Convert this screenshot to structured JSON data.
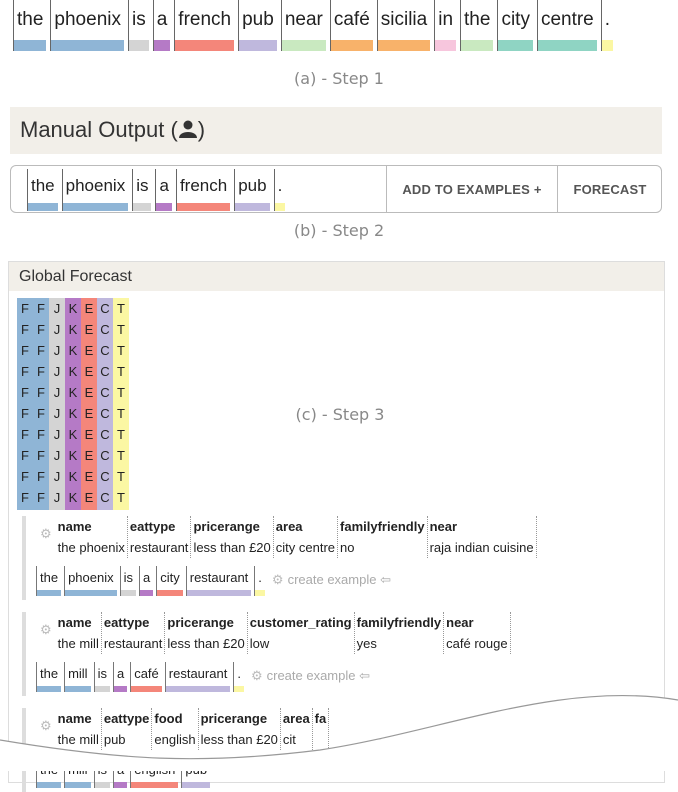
{
  "colors": {
    "blue": "#8fb5d6",
    "gray": "#d4d4d4",
    "purple": "#b57ac6",
    "salmon": "#f4867a",
    "lavender": "#bfb8dd",
    "green": "#c9e9c0",
    "orange": "#f8b26a",
    "pink": "#f7c6dd",
    "teal": "#8fd4c3",
    "yellow": "#fbf7a3",
    "header_bg": "#f2efe9"
  },
  "step1": {
    "tokens": [
      {
        "text": "the",
        "color": "blue"
      },
      {
        "text": "phoenix",
        "color": "blue"
      },
      {
        "text": "is",
        "color": "gray"
      },
      {
        "text": "a",
        "color": "purple"
      },
      {
        "text": "french",
        "color": "salmon"
      },
      {
        "text": "pub",
        "color": "lavender"
      },
      {
        "text": "near",
        "color": "green"
      },
      {
        "text": "café",
        "color": "orange"
      },
      {
        "text": "sicilia",
        "color": "orange"
      },
      {
        "text": "in",
        "color": "pink"
      },
      {
        "text": "the",
        "color": "green"
      },
      {
        "text": "city",
        "color": "teal"
      },
      {
        "text": "centre",
        "color": "teal"
      },
      {
        "text": ".",
        "color": "yellow"
      }
    ],
    "caption": "(a) - Step 1"
  },
  "manual": {
    "title": "Manual Output",
    "user_icon": "user-icon",
    "tokens": [
      {
        "text": "the",
        "color": "blue"
      },
      {
        "text": "phoenix",
        "color": "blue"
      },
      {
        "text": "is",
        "color": "gray"
      },
      {
        "text": "a",
        "color": "purple"
      },
      {
        "text": "french",
        "color": "salmon"
      },
      {
        "text": "pub",
        "color": "lavender"
      },
      {
        "text": ".",
        "color": "yellow"
      }
    ],
    "add_button": "ADD TO EXAMPLES +",
    "forecast_button": "FORECAST",
    "caption": "(b) - Step 2"
  },
  "global": {
    "title": "Global Forecast",
    "caption": "(c) - Step 3",
    "grid": {
      "columns": [
        {
          "letter": "F",
          "color": "blue"
        },
        {
          "letter": "F",
          "color": "blue"
        },
        {
          "letter": "J",
          "color": "gray"
        },
        {
          "letter": "K",
          "color": "purple"
        },
        {
          "letter": "E",
          "color": "salmon"
        },
        {
          "letter": "C",
          "color": "lavender"
        },
        {
          "letter": "T",
          "color": "yellow"
        }
      ],
      "rows": 10
    },
    "examples": [
      {
        "attrs": [
          {
            "k": "name",
            "v": "the phoenix"
          },
          {
            "k": "eattype",
            "v": "restaurant"
          },
          {
            "k": "pricerange",
            "v": "less than £20"
          },
          {
            "k": "area",
            "v": "city centre"
          },
          {
            "k": "familyfriendly",
            "v": "no"
          },
          {
            "k": "near",
            "v": "raja indian cuisine"
          }
        ],
        "tokens": [
          {
            "text": "the",
            "color": "blue"
          },
          {
            "text": "phoenix",
            "color": "blue"
          },
          {
            "text": "is",
            "color": "gray"
          },
          {
            "text": "a",
            "color": "purple"
          },
          {
            "text": "city",
            "color": "salmon"
          },
          {
            "text": "restaurant",
            "color": "lavender"
          },
          {
            "text": ".",
            "color": "yellow"
          }
        ],
        "create_label": "create example ⇦"
      },
      {
        "attrs": [
          {
            "k": "name",
            "v": "the mill"
          },
          {
            "k": "eattype",
            "v": "restaurant"
          },
          {
            "k": "pricerange",
            "v": "less than £20"
          },
          {
            "k": "customer_rating",
            "v": "low"
          },
          {
            "k": "familyfriendly",
            "v": "yes"
          },
          {
            "k": "near",
            "v": "café rouge"
          }
        ],
        "tokens": [
          {
            "text": "the",
            "color": "blue"
          },
          {
            "text": "mill",
            "color": "blue"
          },
          {
            "text": "is",
            "color": "gray"
          },
          {
            "text": "a",
            "color": "purple"
          },
          {
            "text": "café",
            "color": "salmon"
          },
          {
            "text": "restaurant",
            "color": "lavender"
          },
          {
            "text": ".",
            "color": "yellow"
          }
        ],
        "create_label": "create example ⇦"
      },
      {
        "attrs": [
          {
            "k": "name",
            "v": "the mill"
          },
          {
            "k": "eattype",
            "v": "pub"
          },
          {
            "k": "food",
            "v": "english"
          },
          {
            "k": "pricerange",
            "v": "less than £20"
          },
          {
            "k": "area",
            "v": "cit"
          },
          {
            "k": "fa",
            "v": ""
          }
        ],
        "tokens": [
          {
            "text": "the",
            "color": "blue"
          },
          {
            "text": "mill",
            "color": "blue"
          },
          {
            "text": "is",
            "color": "gray"
          },
          {
            "text": "a",
            "color": "purple"
          },
          {
            "text": "english",
            "color": "salmon"
          },
          {
            "text": "pub",
            "color": "lavender"
          }
        ],
        "create_label": ""
      }
    ]
  }
}
